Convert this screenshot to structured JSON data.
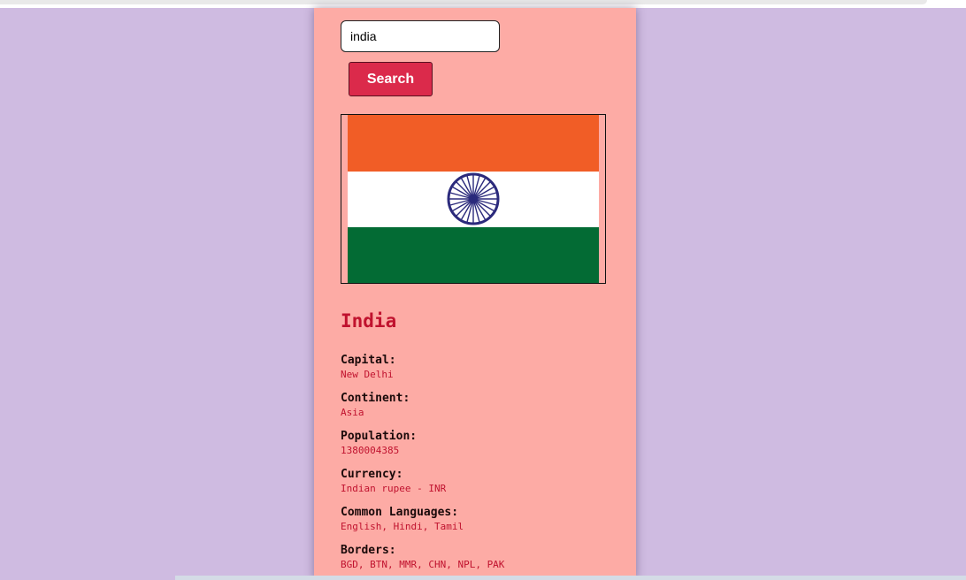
{
  "search": {
    "value": "india",
    "button_label": "Search"
  },
  "flag": {
    "icon": "india-flag",
    "colors": {
      "saffron": "#f15d26",
      "white": "#ffffff",
      "green": "#036b34",
      "chakra": "#2b2a7c"
    }
  },
  "country": {
    "name": "India",
    "details": [
      {
        "label": "Capital:",
        "value": "New Delhi"
      },
      {
        "label": "Continent:",
        "value": "Asia"
      },
      {
        "label": "Population:",
        "value": "1380004385"
      },
      {
        "label": "Currency:",
        "value": "Indian rupee - INR"
      },
      {
        "label": "Common Languages:",
        "value": "English, Hindi, Tamil"
      },
      {
        "label": "Borders:",
        "value": "BGD, BTN, MMR, CHN, NPL, PAK"
      }
    ]
  },
  "colors": {
    "background": "#cfbbe1",
    "card": "#fdaba5",
    "accent": "#db2a4b",
    "value_text": "#c0122e"
  }
}
